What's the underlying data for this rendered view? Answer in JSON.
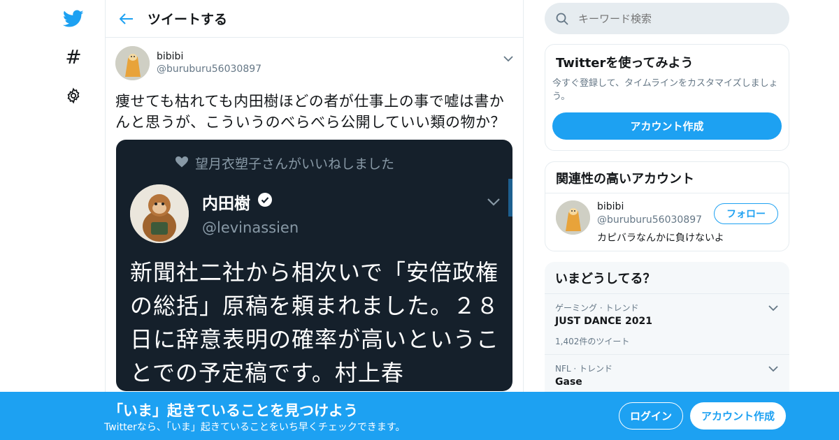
{
  "header": {
    "title": "ツイートする"
  },
  "tweet": {
    "author_name": "bibibi",
    "author_handle": "@buruburu56030897",
    "text": "痩せても枯れても内田樹ほどの者が仕事上の事で嘘は書かんと思うが、こういうのべらべら公開していい類の物か？"
  },
  "embedded_image": {
    "liked_text": "望月衣塑子さんがいいねしました",
    "name": "内田樹",
    "handle": "@levinassien",
    "body": "新聞社二社から相次いで「安倍政権の総括」原稿を頼まれました。２８日に辞意表明の確率が高いということでの予定稿です。村上春"
  },
  "search": {
    "placeholder": "キーワード検索"
  },
  "signup_card": {
    "title": "Twitterを使ってみよう",
    "description": "今すぐ登録して、タイムラインをカスタマイズしましょう。",
    "button": "アカウント作成"
  },
  "related_card": {
    "title": "関連性の高いアカウント",
    "name": "bibibi",
    "handle": "@buruburu56030897",
    "bio": "カピバラなんかに負けないよ",
    "follow_label": "フォロー"
  },
  "trends_card": {
    "title": "いまどうしてる？",
    "items": [
      {
        "meta": "ゲーミング · トレンド",
        "name": "JUST DANCE 2021",
        "count": "1,402件のツイート"
      },
      {
        "meta": "NFL · トレンド",
        "name": "Gase",
        "count": ""
      }
    ]
  },
  "banner": {
    "title": "「いま」起きていることを見つけよう",
    "subtitle": "Twitterなら、「いま」起きていることをいち早くチェックできます。",
    "login_label": "ログイン",
    "signup_label": "アカウント作成"
  },
  "colors": {
    "accent": "#1da1f2",
    "dark_bg": "#15202b",
    "muted": "#657786",
    "border": "#e6ecf0"
  }
}
